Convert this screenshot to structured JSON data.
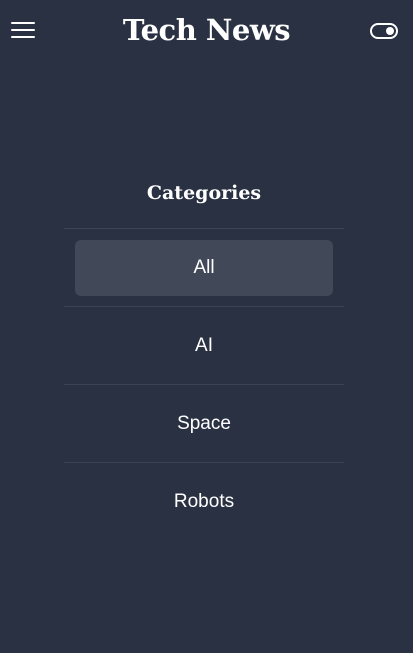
{
  "header": {
    "title": "Tech News",
    "menu_icon": "hamburger-menu-icon",
    "theme_icon": "toggle-switch-icon"
  },
  "categories": {
    "heading": "Categories",
    "items": [
      {
        "label": "All",
        "active": true
      },
      {
        "label": "AI",
        "active": false
      },
      {
        "label": "Space",
        "active": false
      },
      {
        "label": "Robots",
        "active": false
      }
    ]
  },
  "colors": {
    "background": "#2a3142",
    "active_item_background": "#414857",
    "divider": "#3b4354",
    "text": "#ffffff"
  }
}
